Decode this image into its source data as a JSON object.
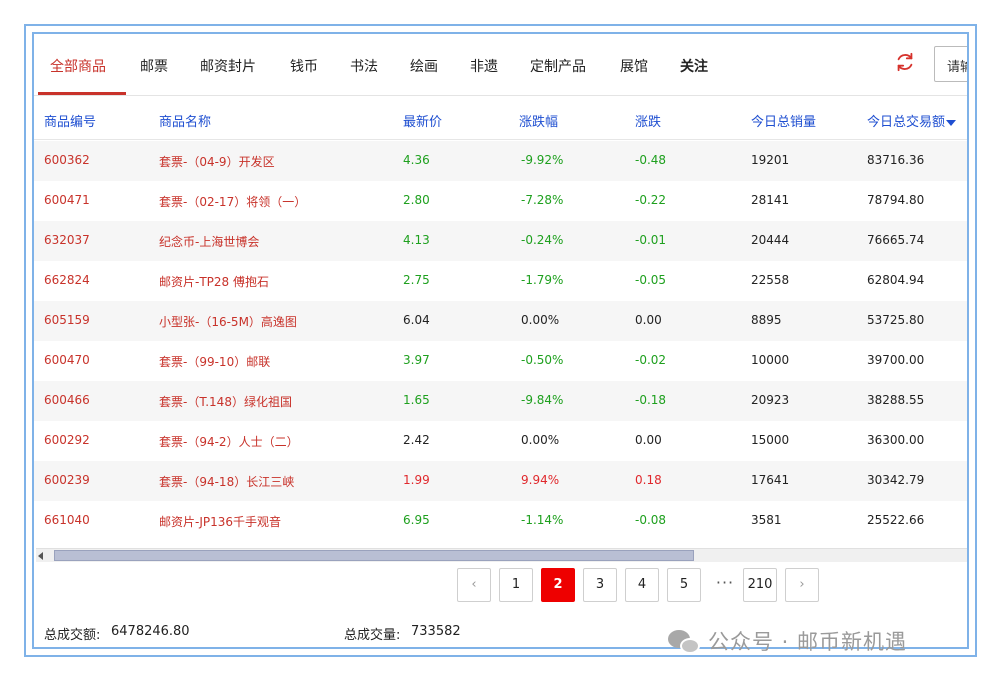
{
  "tabs": [
    {
      "label": "全部商品",
      "active": true
    },
    {
      "label": "邮票"
    },
    {
      "label": "邮资封片"
    },
    {
      "label": "钱币"
    },
    {
      "label": "书法"
    },
    {
      "label": "绘画"
    },
    {
      "label": "非遗"
    },
    {
      "label": "定制产品"
    },
    {
      "label": "展馆"
    },
    {
      "label": "关注"
    }
  ],
  "search": {
    "visible_text": "请输"
  },
  "colors": {
    "accent": "#c8322a",
    "header_blue": "#1f4fd1",
    "up": "#e0282c",
    "down": "#1ea01e",
    "frame": "#7fb2e8"
  },
  "table": {
    "columns": [
      "商品编号",
      "商品名称",
      "最新价",
      "涨跌幅",
      "涨跌",
      "今日总销量",
      "今日总交易额"
    ],
    "rows": [
      {
        "code": "600362",
        "name": "套票-（04-9）开发区",
        "price": "4.36",
        "pct": "-9.92%",
        "chg": "-0.48",
        "volume": "19201",
        "amount": "83716.36",
        "trend": "down"
      },
      {
        "code": "600471",
        "name": "套票-（02-17）将领（一）",
        "price": "2.80",
        "pct": "-7.28%",
        "chg": "-0.22",
        "volume": "28141",
        "amount": "78794.80",
        "trend": "down"
      },
      {
        "code": "632037",
        "name": "纪念币-上海世博会",
        "price": "4.13",
        "pct": "-0.24%",
        "chg": "-0.01",
        "volume": "20444",
        "amount": "76665.74",
        "trend": "down"
      },
      {
        "code": "662824",
        "name": "邮资片-TP28 傅抱石",
        "price": "2.75",
        "pct": "-1.79%",
        "chg": "-0.05",
        "volume": "22558",
        "amount": "62804.94",
        "trend": "down"
      },
      {
        "code": "605159",
        "name": "小型张-（16-5M）高逸图",
        "price": "6.04",
        "pct": "0.00%",
        "chg": "0.00",
        "volume": "8895",
        "amount": "53725.80",
        "trend": "flat"
      },
      {
        "code": "600470",
        "name": "套票-（99-10）邮联",
        "price": "3.97",
        "pct": "-0.50%",
        "chg": "-0.02",
        "volume": "10000",
        "amount": "39700.00",
        "trend": "down"
      },
      {
        "code": "600466",
        "name": "套票-（T.148）绿化祖国",
        "price": "1.65",
        "pct": "-9.84%",
        "chg": "-0.18",
        "volume": "20923",
        "amount": "38288.55",
        "trend": "down"
      },
      {
        "code": "600292",
        "name": "套票-（94-2）人士（二）",
        "price": "2.42",
        "pct": "0.00%",
        "chg": "0.00",
        "volume": "15000",
        "amount": "36300.00",
        "trend": "flat"
      },
      {
        "code": "600239",
        "name": "套票-（94-18）长江三峡",
        "price": "1.99",
        "pct": "9.94%",
        "chg": "0.18",
        "volume": "17641",
        "amount": "30342.79",
        "trend": "up"
      },
      {
        "code": "661040",
        "name": "邮资片-JP136千手观音",
        "price": "6.95",
        "pct": "-1.14%",
        "chg": "-0.08",
        "volume": "3581",
        "amount": "25522.66",
        "trend": "down"
      }
    ]
  },
  "pagination": {
    "prev": "‹",
    "next": "›",
    "pages": [
      "1",
      "2",
      "3",
      "4",
      "5"
    ],
    "current": "2",
    "ellipsis": "···",
    "last": "210"
  },
  "footer": {
    "total_amount_label": "总成交额:",
    "total_amount": "6478246.80",
    "total_volume_label": "总成交量:",
    "total_volume": "733582"
  },
  "watermark": {
    "text": "公众号 · 邮币新机遇"
  }
}
